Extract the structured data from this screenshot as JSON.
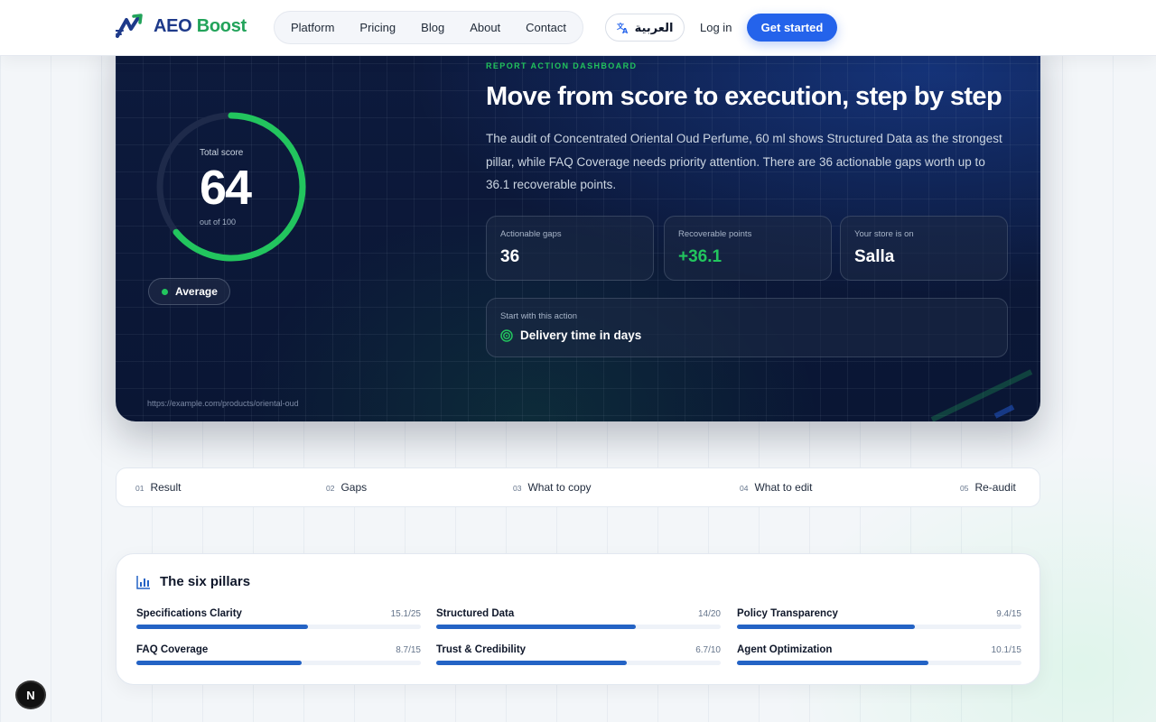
{
  "brand": {
    "part1": "AEO",
    "part2": "Boost",
    "primary_color": "#2463eb",
    "accent_green": "#22c55e"
  },
  "nav": {
    "items": [
      "Platform",
      "Pricing",
      "Blog",
      "About",
      "Contact"
    ],
    "language_label": "العربية",
    "login_label": "Log in",
    "cta_label": "Get started"
  },
  "hero": {
    "eyebrow": "REPORT ACTION DASHBOARD",
    "title": "Move from score to execution, step by step",
    "description": "The audit of Concentrated Oriental Oud Perfume, 60 ml shows Structured Data as the strongest pillar, while FAQ Coverage needs priority attention. There are 36 actionable gaps worth up to 36.1 recoverable points.",
    "score": {
      "label": "Total score",
      "value": "64",
      "sub": "out of 100",
      "percent": 64
    },
    "badge": "Average",
    "url": "https://example.com/products/oriental-oud",
    "stats": [
      {
        "label": "Actionable gaps",
        "value": "36"
      },
      {
        "label": "Recoverable points",
        "value": "+36.1"
      },
      {
        "label": "Your store is on",
        "value": "Salla"
      }
    ],
    "action": {
      "label": "Start with this action",
      "value": "Delivery time in days"
    }
  },
  "steps": [
    {
      "num": "01",
      "label": "Result"
    },
    {
      "num": "02",
      "label": "Gaps"
    },
    {
      "num": "03",
      "label": "What to copy"
    },
    {
      "num": "04",
      "label": "What to edit"
    },
    {
      "num": "05",
      "label": "Re-audit"
    }
  ],
  "pillars": {
    "title": "The six pillars",
    "items": [
      {
        "name": "Specifications Clarity",
        "score": "15.1/25",
        "value": 15.1,
        "max": 25
      },
      {
        "name": "Structured Data",
        "score": "14/20",
        "value": 14,
        "max": 20
      },
      {
        "name": "Policy Transparency",
        "score": "9.4/15",
        "value": 9.4,
        "max": 15
      },
      {
        "name": "FAQ Coverage",
        "score": "8.7/15",
        "value": 8.7,
        "max": 15
      },
      {
        "name": "Trust & Credibility",
        "score": "6.7/10",
        "value": 6.7,
        "max": 10
      },
      {
        "name": "Agent Optimization",
        "score": "10.1/15",
        "value": 10.1,
        "max": 15
      }
    ]
  },
  "dev_badge": "N"
}
